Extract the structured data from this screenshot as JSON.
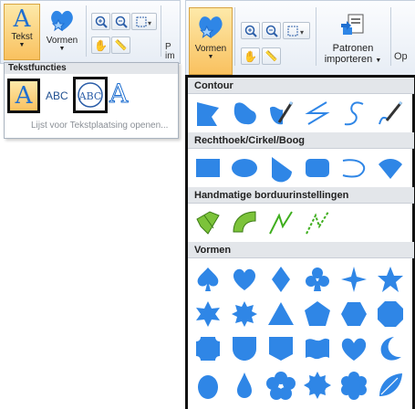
{
  "left_ribbon": {
    "text_button_label": "Tekst",
    "shapes_button_label": "Vormen",
    "truncated_label_1": "P",
    "truncated_label_2": "im"
  },
  "text_dropdown": {
    "header": "Tekstfuncties",
    "sample_abc": "ABC",
    "sample_monogram": "ABC",
    "footer_link": "Lijst voor Tekstplaatsing openen..."
  },
  "right_ribbon": {
    "shapes_button_label": "Vormen",
    "import_label_1": "Patronen",
    "import_label_2": "importeren",
    "truncated_label": "Op"
  },
  "shapes_panel": {
    "sections": [
      {
        "title": "Contour",
        "shapes": [
          "contour-polygon",
          "contour-blob",
          "contour-freehand-brush",
          "contour-zigzag-line",
          "contour-s-curve",
          "contour-curve-brush"
        ]
      },
      {
        "title": "Rechthoek/Cirkel/Boog",
        "shapes": [
          "rectangle",
          "ellipse",
          "fan-sector",
          "rounded-rectangle",
          "arc",
          "chord"
        ]
      },
      {
        "title": "Handmatige borduurinstellingen",
        "shapes": [
          "manual-block-straight",
          "manual-block-curved",
          "manual-line",
          "manual-dashed-line"
        ]
      },
      {
        "title": "Vormen",
        "shapes": [
          "spade",
          "heart",
          "diamond",
          "club",
          "four-point-star",
          "five-point-star",
          "six-point-star",
          "eight-point-star",
          "triangle",
          "pentagon",
          "hexagon",
          "octagon",
          "cut-square",
          "shield",
          "badge",
          "wave-flag",
          "heart-rounded",
          "crescent",
          "egg",
          "drop",
          "flower-five",
          "flower-eight",
          "flower-six",
          "leaf"
        ]
      }
    ]
  },
  "colors": {
    "accent": "#2f86e6",
    "selected": "#f9c15f",
    "panel_border": "#111111"
  }
}
